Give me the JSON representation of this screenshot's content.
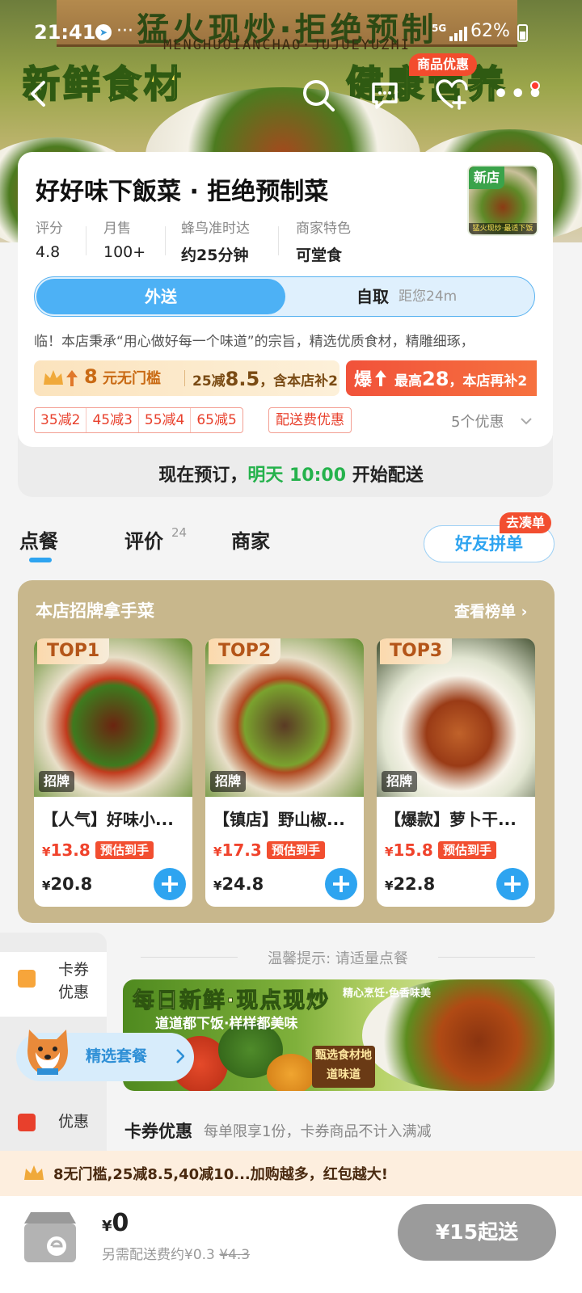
{
  "status_bar": {
    "time": "21:41",
    "dots": "···",
    "network": "5G",
    "battery": "62%"
  },
  "hero": {
    "sign_title": "猛火现炒·拒绝预制",
    "sign_pinyin": "MENGHUOIANCHAO·JUJUEYUZHI",
    "left_slogan": "新鲜食材",
    "right_slogan": "健康营养",
    "promo_tag": "商品优惠"
  },
  "shop": {
    "name": "好好味下飯菜 · 拒绝预制菜",
    "new_badge": "新店",
    "thumb_caption": "猛火现炒·最适下饭",
    "stats": [
      {
        "label": "评分",
        "value": "4.8"
      },
      {
        "label": "月售",
        "value": "100+"
      },
      {
        "label": "蜂鸟准时达",
        "value": "约25分钟"
      },
      {
        "label": "商家特色",
        "value": "可堂食"
      }
    ],
    "mode_active": "外送",
    "mode_inactive": "自取",
    "distance": "距您24m",
    "description": "临！本店秉承“用心做好每一个味道”的宗旨，精选优质食材，精雕细琢，",
    "coupon_a": {
      "prefix": "8",
      "unit": "元无门槛",
      "rest_a": "25减",
      "rest_big": "8.5",
      "rest_b": "，含本店补2"
    },
    "coupon_b": {
      "label": "爆",
      "text_a": "最高",
      "text_big": "28",
      "text_b": "，本店再补2"
    },
    "discounts": [
      "35减2",
      "45减3",
      "55减4",
      "65减5"
    ],
    "fee_discount": "配送费优惠",
    "more_discounts": "5个优惠"
  },
  "preorder": {
    "prefix": "现在预订，",
    "highlight": "明天 10:00",
    "suffix": "开始配送"
  },
  "tabs": {
    "order": "点餐",
    "reviews": "评价",
    "reviews_count": "24",
    "merchant": "商家"
  },
  "group_order": {
    "label": "好友拼单",
    "tag": "去凑单"
  },
  "signature": {
    "title": "本店招牌拿手菜",
    "more": "查看榜单 ›",
    "dishes": [
      {
        "rank": "TOP1",
        "badge": "招牌",
        "name": "【人气】好味小...",
        "price": "13.8",
        "est": "预估到手",
        "orig": "20.8"
      },
      {
        "rank": "TOP2",
        "badge": "招牌",
        "name": "【镇店】野山椒...",
        "price": "17.3",
        "est": "预估到手",
        "orig": "24.8"
      },
      {
        "rank": "TOP3",
        "badge": "招牌",
        "name": "【爆款】萝卜干...",
        "price": "15.8",
        "est": "预估到手",
        "orig": "22.8"
      }
    ]
  },
  "sidebar": {
    "items": [
      {
        "label": "卡券优惠"
      },
      {
        "label": "优惠"
      }
    ]
  },
  "combo": {
    "label": "精选套餐"
  },
  "tip": "温馨提示: 请适量点餐",
  "banner": {
    "title": "每日新鲜·现点现炒",
    "sub": "道道都下饭·样样都美味",
    "tag": "甄选食材地道味道",
    "right_caption": "精心烹饪·色香味美"
  },
  "coupon_section": {
    "title": "卡券优惠",
    "sub": "每单限享1份，卡券商品不计入满减"
  },
  "promo_strip": "8无门槛,25减8.5,40减10...加购越多，红包越大!",
  "cart": {
    "currency": "¥",
    "total": "0",
    "fee_label": "另需配送费约",
    "fee_new": "¥0.3",
    "fee_old": "¥4.3",
    "min_order": "¥15起送"
  },
  "colors": {
    "accent_blue": "#2ea4f0",
    "price_red": "#f0432c",
    "green": "#25b24c",
    "gold_panel": "#c8b78c"
  }
}
